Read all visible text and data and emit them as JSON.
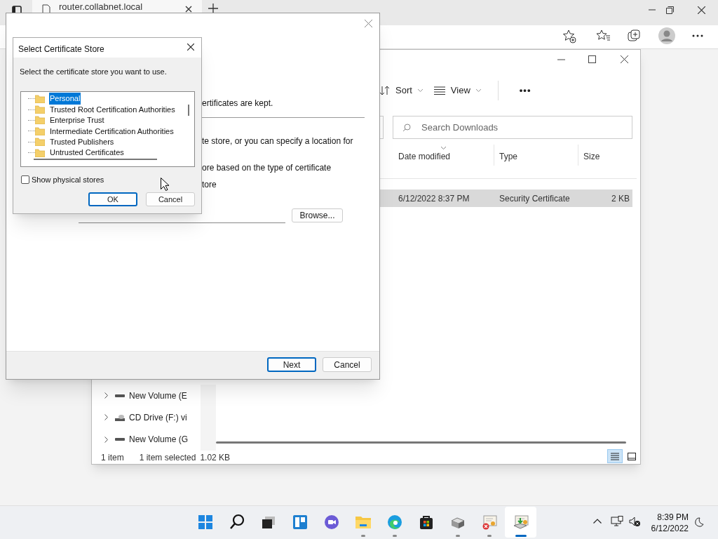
{
  "browser": {
    "tab_title": "router.collabnet.local"
  },
  "explorer": {
    "toolbar": [
      {
        "kind": "sort",
        "label": "Sort"
      },
      {
        "kind": "view",
        "label": "View"
      },
      {
        "kind": "more",
        "label": "•••"
      }
    ],
    "search": {
      "placeholder": "Search Downloads"
    },
    "columns": [
      "Date modified",
      "Type",
      "Size"
    ],
    "rows": [
      {
        "date": "6/12/2022 8:37 PM",
        "type": "Security Certificate",
        "size": "2 KB",
        "selected": true
      }
    ],
    "nav_items": [
      {
        "kind": "drive",
        "label": "New Volume (E"
      },
      {
        "kind": "cd",
        "label": "CD Drive (F:) vi"
      },
      {
        "kind": "drive",
        "label": "New Volume (G"
      }
    ],
    "status_bar": {
      "count": "1 item",
      "selection": "1 item selected",
      "size": "1.02 KB"
    },
    "view_modes": [
      {
        "kind": "details",
        "selected": true
      },
      {
        "kind": "tiles",
        "selected": false
      }
    ]
  },
  "wizard": {
    "texts": [
      "ertificates are kept.",
      "te store, or you can specify a location for",
      "ore based on the type of certificate",
      "tore"
    ],
    "browse_button": "Browse...",
    "buttons": [
      {
        "label": "Next",
        "default": true
      },
      {
        "label": "Cancel",
        "default": false
      }
    ]
  },
  "store_dialog": {
    "title": "Select Certificate Store",
    "prompt": "Select the certificate store you want to use.",
    "stores": [
      {
        "label": "Personal",
        "selected": true
      },
      {
        "label": "Trusted Root Certification Authorities",
        "selected": false
      },
      {
        "label": "Enterprise Trust",
        "selected": false
      },
      {
        "label": "Intermediate Certification Authorities",
        "selected": false
      },
      {
        "label": "Trusted Publishers",
        "selected": false
      },
      {
        "label": "Untrusted Certificates",
        "selected": false
      }
    ],
    "show_physical": {
      "label": "Show physical stores",
      "checked": false
    },
    "buttons": [
      {
        "label": "OK",
        "default": true
      },
      {
        "label": "Cancel",
        "default": false
      }
    ]
  },
  "taskbar": {
    "apps": [
      {
        "kind": "start",
        "running": false
      },
      {
        "kind": "search",
        "running": false
      },
      {
        "kind": "taskview",
        "running": false
      },
      {
        "kind": "widgets",
        "running": false
      },
      {
        "kind": "chat",
        "running": false
      },
      {
        "kind": "folder",
        "running": true
      },
      {
        "kind": "edge",
        "running": true
      },
      {
        "kind": "store",
        "running": false
      },
      {
        "kind": "drive",
        "running": true
      },
      {
        "kind": "cert",
        "running": true
      },
      {
        "kind": "certwizard",
        "running": true,
        "selected": true
      }
    ],
    "time": "8:39 PM",
    "date": "6/12/2022"
  }
}
